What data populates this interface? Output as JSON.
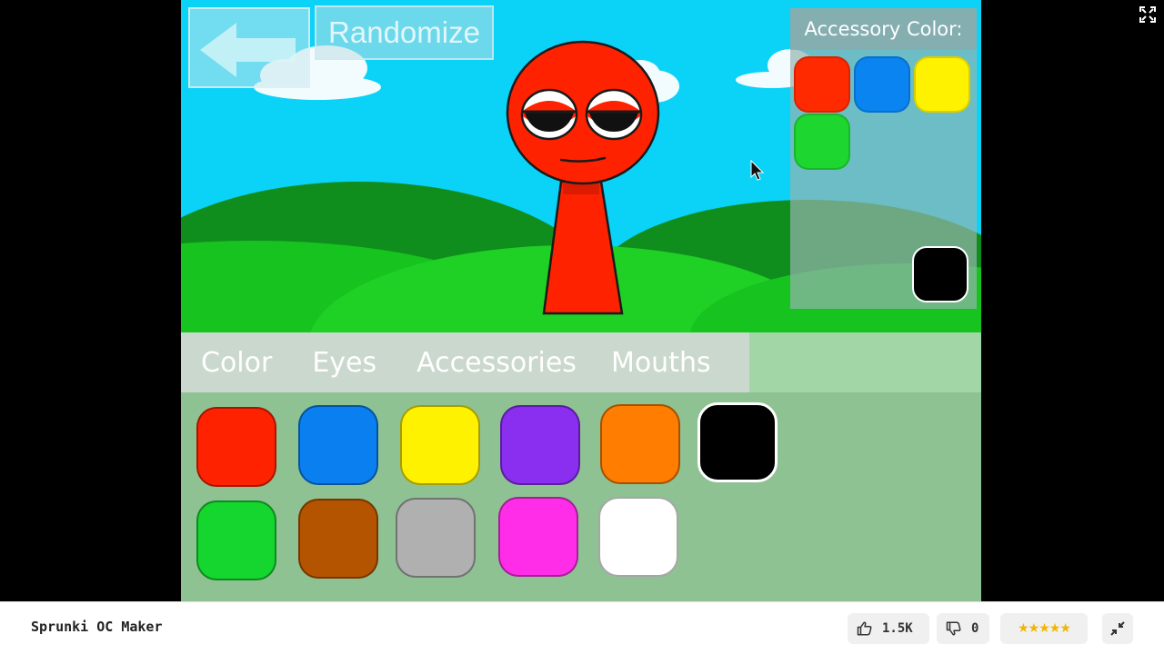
{
  "game": {
    "randomize_label": "Randomize",
    "accessory_panel": {
      "title": "Accessory Color:",
      "swatches": [
        {
          "name": "red",
          "color": "#ff2a00"
        },
        {
          "name": "blue",
          "color": "#0a84f0"
        },
        {
          "name": "yellow",
          "color": "#fff200"
        },
        {
          "name": "green",
          "color": "#1ed630"
        },
        {
          "name": "black",
          "color": "#000000"
        }
      ]
    },
    "tabs": [
      {
        "label": "Color"
      },
      {
        "label": "Eyes"
      },
      {
        "label": "Accessories"
      },
      {
        "label": "Mouths"
      }
    ],
    "colors": [
      {
        "name": "red",
        "color": "#ff2200"
      },
      {
        "name": "blue",
        "color": "#0a80f0"
      },
      {
        "name": "yellow",
        "color": "#fff200"
      },
      {
        "name": "purple",
        "color": "#8a2ef0"
      },
      {
        "name": "orange",
        "color": "#ff7d00"
      },
      {
        "name": "black",
        "color": "#000000",
        "selected": true
      },
      {
        "name": "green",
        "color": "#14d62e"
      },
      {
        "name": "brown",
        "color": "#b55400"
      },
      {
        "name": "gray",
        "color": "#b0b0b0"
      },
      {
        "name": "pink",
        "color": "#ff2de8"
      },
      {
        "name": "white",
        "color": "#ffffff"
      }
    ],
    "character_color": "#ff2200",
    "sky_color": "#0bd2f7"
  },
  "bottombar": {
    "title": "Sprunki OC Maker",
    "likes": "1.5K",
    "dislikes": "0",
    "rating_stars": "★★★★★"
  }
}
